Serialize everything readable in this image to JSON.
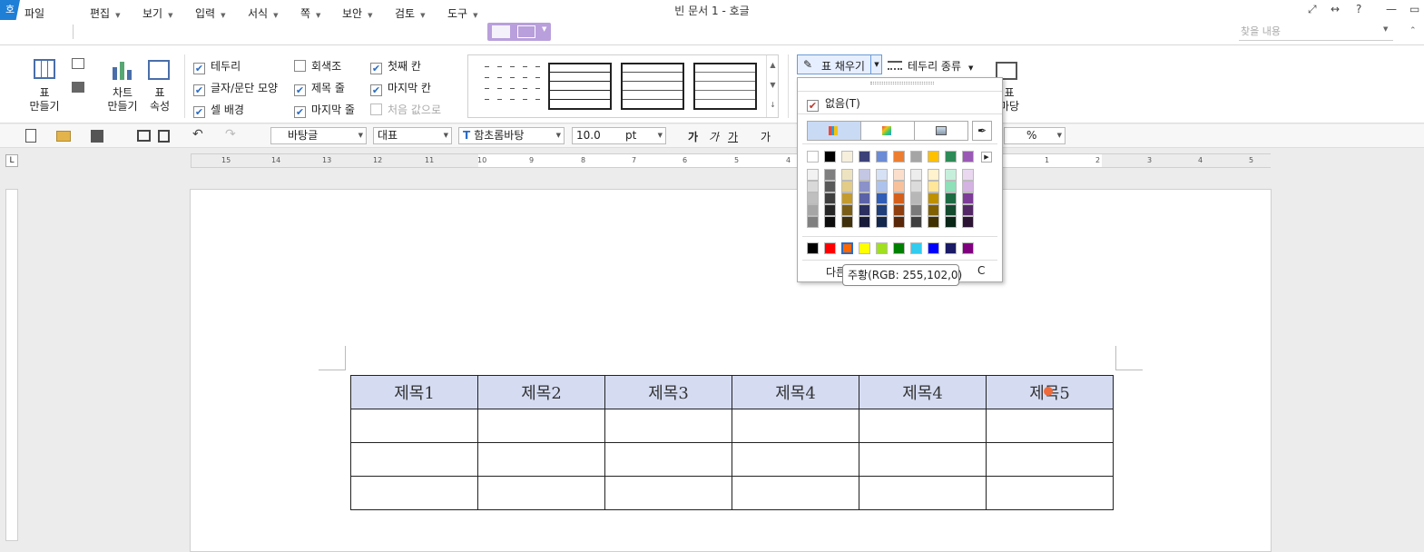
{
  "window": {
    "title": "빈 문서 1 - 호글",
    "logo": "호"
  },
  "menu": [
    {
      "label": "파일",
      "arrow": false
    },
    {
      "label": "편집",
      "arrow": true
    },
    {
      "label": "보기",
      "arrow": true
    },
    {
      "label": "입력",
      "arrow": true
    },
    {
      "label": "서식",
      "arrow": true
    },
    {
      "label": "쪽",
      "arrow": true
    },
    {
      "label": "보안",
      "arrow": true
    },
    {
      "label": "검토",
      "arrow": true
    },
    {
      "label": "도구",
      "arrow": true
    }
  ],
  "search": {
    "placeholder": "찾을 내용"
  },
  "ribbon": {
    "table_make": "표\n만들기",
    "chart_make": "차트\n만들기",
    "table_props": "표\n속성",
    "checks": [
      {
        "label": "테두리",
        "checked": true
      },
      {
        "label": "글자/문단 모양",
        "checked": true
      },
      {
        "label": "셀 배경",
        "checked": true
      },
      {
        "label": "회색조",
        "checked": false
      },
      {
        "label": "제목 줄",
        "checked": true
      },
      {
        "label": "마지막 줄",
        "checked": true
      },
      {
        "label": "첫째 칸",
        "checked": true
      },
      {
        "label": "마지막 칸",
        "checked": true
      }
    ],
    "reset_label": "처음 값으로",
    "fill_button": "표 채우기",
    "border_type": "테두리 종류",
    "partial_right": "표\n마당"
  },
  "toolbar": {
    "style": "바탕글",
    "lang": "대표",
    "font": "함초롬바탕",
    "size": "10.0",
    "unit": "pt",
    "bold": "가",
    "italic": "가",
    "underline": "가",
    "strike": "가",
    "percent_unit": "%"
  },
  "ruler_numbers": [
    "15",
    "14",
    "13",
    "12",
    "11",
    "10",
    "9",
    "8",
    "7",
    "6",
    "5",
    "4",
    "3",
    "2",
    "1",
    "1",
    "2",
    "3",
    "4",
    "5"
  ],
  "table": {
    "headers": [
      "제목1",
      "제목2",
      "제목3",
      "제목4",
      "제목4",
      "제목5"
    ],
    "body_rows": 3
  },
  "fill_menu": {
    "none_label": "없음(T)",
    "more_label": "다른",
    "more_suffix": "C",
    "base_row": [
      "#ffffff",
      "#000000",
      "#f5efdc",
      "#3c4078",
      "#6b8bd6",
      "#ed7d31",
      "#a5a5a5",
      "#ffc000",
      "#2e8b57",
      "#9b59b6"
    ],
    "shades": [
      [
        "#f2f2f2",
        "#7f7f7f",
        "#eee3c0",
        "#c4c7e3",
        "#d6e1f6",
        "#fbdfcc",
        "#ededed",
        "#fff2cc",
        "#c6efdb",
        "#e9d8f0"
      ],
      [
        "#d9d9d9",
        "#595959",
        "#e3cc87",
        "#8b91c9",
        "#adc3ed",
        "#f7c19c",
        "#dbdbdb",
        "#ffe699",
        "#8fdfb8",
        "#d4b2e1"
      ],
      [
        "#bfbfbf",
        "#3f3f3f",
        "#c49b2e",
        "#5b62a8",
        "#2f5db8",
        "#d5601b",
        "#b7b7b7",
        "#bf9000",
        "#1e6b43",
        "#7d3c98"
      ],
      [
        "#a6a6a6",
        "#262626",
        "#7a5e17",
        "#2a2f60",
        "#1f3e7a",
        "#8f3f10",
        "#7a7a7a",
        "#806000",
        "#144a2e",
        "#542867"
      ],
      [
        "#808080",
        "#0d0d0d",
        "#3f2f0b",
        "#171a38",
        "#13264b",
        "#582609",
        "#3f3f3f",
        "#403000",
        "#0a2617",
        "#2b1434"
      ]
    ],
    "standard": [
      "#000000",
      "#ff0000",
      "#ff6600",
      "#ffff00",
      "#a0e01e",
      "#008000",
      "#33ccee",
      "#0000ff",
      "#1a1a66",
      "#800080"
    ],
    "selected_index": 2,
    "tooltip": "주황(RGB: 255,102,0)"
  }
}
